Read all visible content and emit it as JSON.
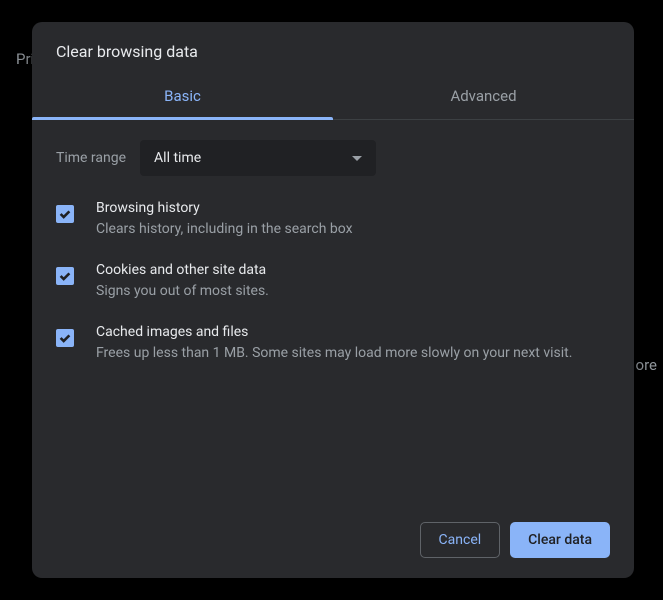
{
  "background": {
    "left_text": "Priv",
    "right_text": "ore"
  },
  "dialog": {
    "title": "Clear browsing data",
    "tabs": {
      "basic": "Basic",
      "advanced": "Advanced"
    },
    "time_range": {
      "label": "Time range",
      "value": "All time"
    },
    "options": [
      {
        "title": "Browsing history",
        "desc": "Clears history, including in the search box"
      },
      {
        "title": "Cookies and other site data",
        "desc": "Signs you out of most sites."
      },
      {
        "title": "Cached images and files",
        "desc": "Frees up less than 1 MB. Some sites may load more slowly on your next visit."
      }
    ],
    "actions": {
      "cancel": "Cancel",
      "clear": "Clear data"
    }
  }
}
